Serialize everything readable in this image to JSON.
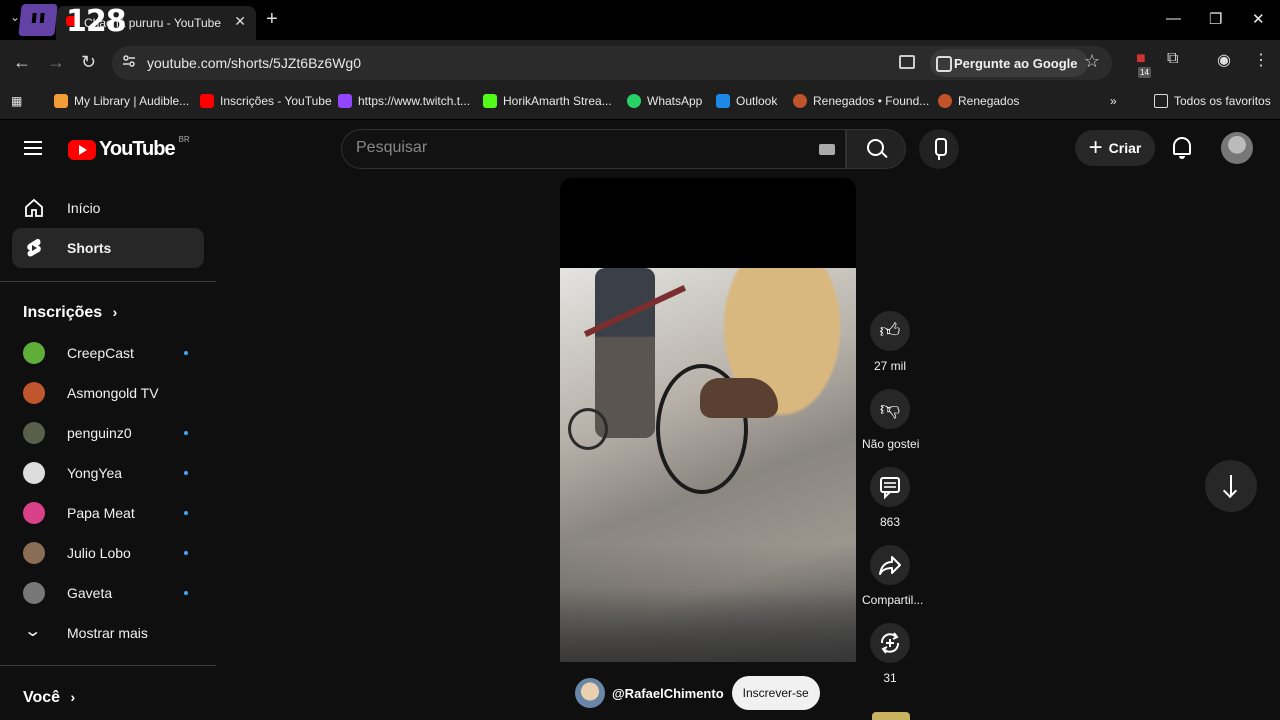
{
  "overlay": {
    "counter": "128"
  },
  "browser": {
    "tab_title": "Chachá pururu - YouTube",
    "url": "youtube.com/shorts/5JZt6Bz6Wg0",
    "ask_google_label": "Pergunte ao Google",
    "extension_badge": "14",
    "bookmarks": [
      {
        "label": "My Library | Audible...",
        "icon": "audible-icon",
        "color": "#f29d38"
      },
      {
        "label": "Inscrições - YouTube",
        "icon": "youtube-icon",
        "color": "#ff0000"
      },
      {
        "label": "https://www.twitch.t...",
        "icon": "twitch-icon",
        "color": "#9146ff"
      },
      {
        "label": "HorikAmarth Strea...",
        "icon": "kick-icon",
        "color": "#53fc18"
      },
      {
        "label": "WhatsApp",
        "icon": "whatsapp-icon",
        "color": "#25d366"
      },
      {
        "label": "Outlook",
        "icon": "outlook-icon",
        "color": "#1e88e5"
      },
      {
        "label": "Renegados • Found...",
        "icon": "renegados-icon",
        "color": "#c0532a"
      },
      {
        "label": "Renegados",
        "icon": "renegados-icon",
        "color": "#c0532a"
      }
    ],
    "all_bookmarks_label": "Todos os favoritos"
  },
  "youtube": {
    "logo_wordmark": "YouTube",
    "logo_region": "BR",
    "search_placeholder": "Pesquisar",
    "create_label": "Criar",
    "nav": [
      {
        "label": "Início",
        "icon": "home-icon"
      },
      {
        "label": "Shorts",
        "icon": "shorts-icon"
      }
    ],
    "subscriptions_title": "Inscrições",
    "subscriptions": [
      {
        "name": "CreepCast",
        "new": true,
        "color": "#5fae3a"
      },
      {
        "name": "Asmongold TV",
        "new": false,
        "color": "#c0552e"
      },
      {
        "name": "penguinz0",
        "new": true,
        "color": "#5a5f4a"
      },
      {
        "name": "YongYea",
        "new": true,
        "color": "#dddddd"
      },
      {
        "name": "Papa Meat",
        "new": true,
        "color": "#d9408a"
      },
      {
        "name": "Julio Lobo",
        "new": true,
        "color": "#8a6d55"
      },
      {
        "name": "Gaveta",
        "new": true,
        "color": "#777777"
      }
    ],
    "show_more_label": "Mostrar mais",
    "you_title": "Você",
    "short": {
      "channel": "@RafaelChimento",
      "subscribe_label": "Inscrever-se",
      "likes": "27 mil",
      "dislike_label": "Não gostei",
      "comments": "863",
      "share_label": "Compartil...",
      "remix_count": "31"
    }
  }
}
